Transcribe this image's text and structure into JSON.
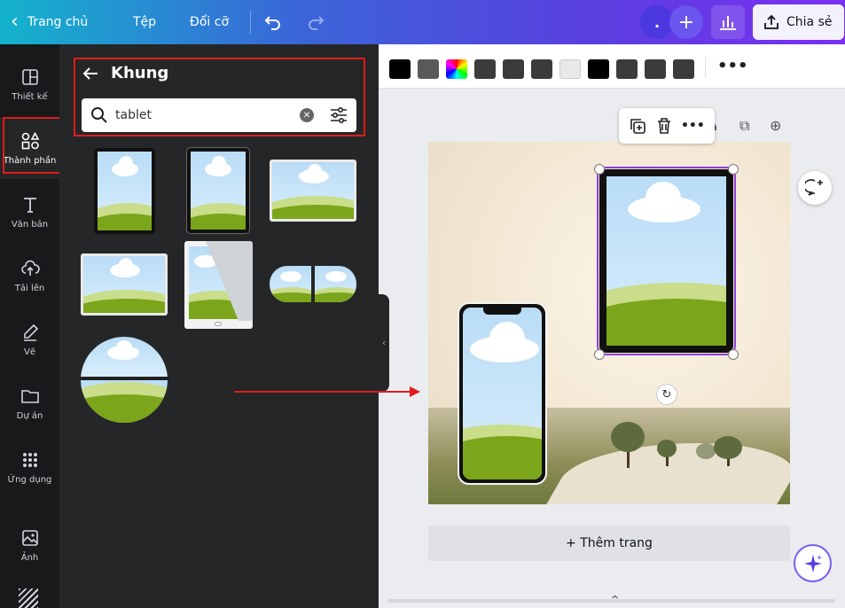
{
  "topbar": {
    "home_label": "Trang chủ",
    "file_label": "Tệp",
    "resize_label": "Đổi cỡ",
    "avatar_text": ".",
    "share_label": "Chia sẻ"
  },
  "rail": {
    "items": [
      {
        "label": "Thiết kế",
        "icon": "layout-icon"
      },
      {
        "label": "Thành phần",
        "icon": "shapes-icon"
      },
      {
        "label": "Văn bản",
        "icon": "text-icon"
      },
      {
        "label": "Tải lên",
        "icon": "upload-icon"
      },
      {
        "label": "Vẽ",
        "icon": "draw-icon"
      },
      {
        "label": "Dự án",
        "icon": "folder-icon"
      },
      {
        "label": "Ứng dụng",
        "icon": "apps-icon"
      },
      {
        "label": "Ảnh",
        "icon": "image-icon"
      }
    ]
  },
  "panel": {
    "title": "Khung",
    "search_value": "tablet"
  },
  "toolbar": {
    "swatches": [
      "#000000",
      "#595959",
      "rainbow",
      "#3b3b3b",
      "#3b3b3b",
      "#3b3b3b",
      "#e8e8e8",
      "#000000",
      "#3b3b3b",
      "#3b3b3b",
      "#3b3b3b"
    ]
  },
  "editor": {
    "add_page_label": "+ Thêm trang"
  },
  "colors": {
    "highlight": "#e01b1b",
    "selection": "#8b3fd9"
  }
}
